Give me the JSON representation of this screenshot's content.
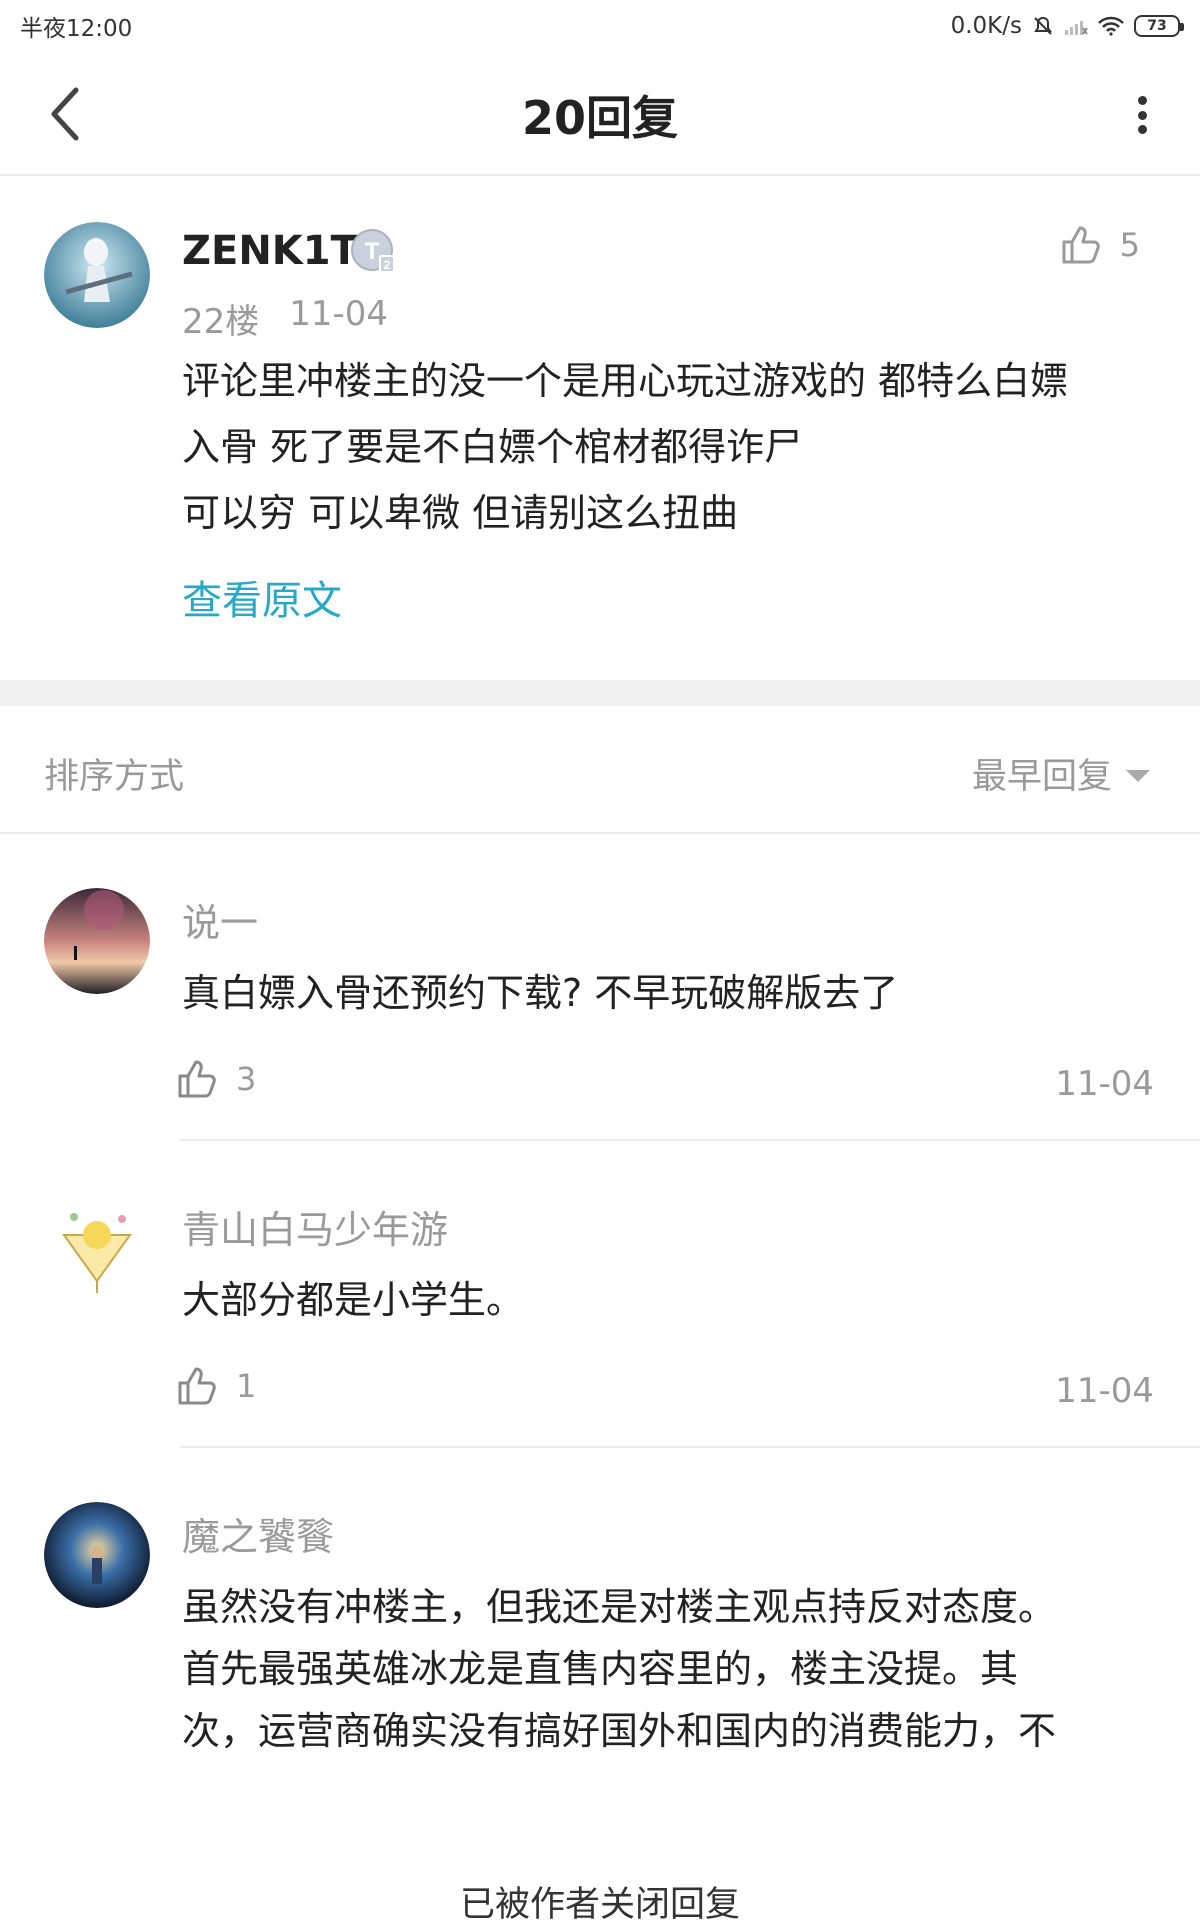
{
  "status_bar": {
    "time": "半夜12:00",
    "net_speed": "0.0K/s",
    "battery": "73",
    "icons": [
      "mute-icon",
      "signal-icon",
      "wifi-icon",
      "battery-icon"
    ]
  },
  "header": {
    "title": "20回复",
    "back_icon": "chevron-left-icon",
    "more_icon": "more-vertical-icon"
  },
  "post": {
    "author": "ZENK1T",
    "badge": "T",
    "badge_sub": "2",
    "floor": "22楼",
    "date": "11-04",
    "likes": "5",
    "lines": [
      "评论里冲楼主的没一个是用心玩过游戏的 都特么白嫖",
      "入骨 死了要是不白嫖个棺材都得诈尸",
      "可以穷 可以卑微 但请别这么扭曲"
    ],
    "view_original": "查看原文"
  },
  "sort": {
    "label": "排序方式",
    "selected": "最早回复"
  },
  "replies": [
    {
      "author": "说一",
      "lines": [
        "真白嫖入骨还预约下载? 不早玩破解版去了"
      ],
      "likes": "3",
      "date": "11-04"
    },
    {
      "author": "青山白马少年游",
      "lines": [
        "大部分都是小学生。"
      ],
      "likes": "1",
      "date": "11-04"
    },
    {
      "author": "魔之饕餮",
      "lines": [
        "虽然没有冲楼主，但我还是对楼主观点持反对态度。",
        "首先最强英雄冰龙是直售内容里的，楼主没提。其",
        "次，运营商确实没有搞好国外和国内的消费能力，不"
      ]
    }
  ],
  "footer": {
    "note": "已被作者关闭回复"
  },
  "colors": {
    "accent": "#27a8c9",
    "muted_text": "#9a9a9a",
    "divider": "#ededed"
  }
}
